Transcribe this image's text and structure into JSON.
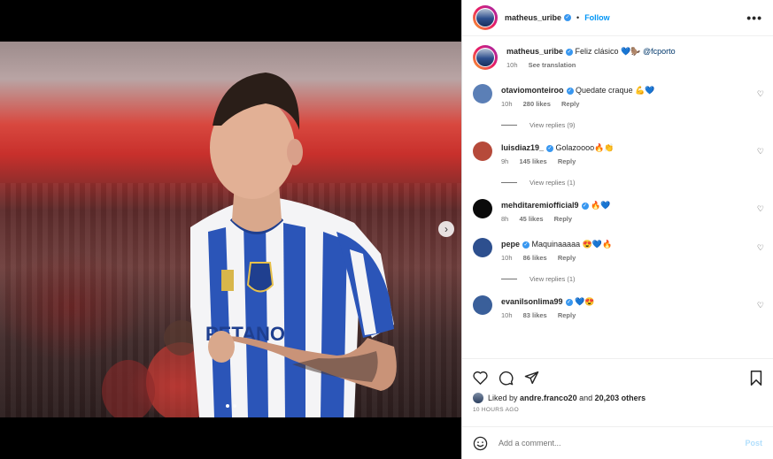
{
  "post": {
    "username": "matheus_uribe",
    "follow_label": "Follow",
    "separator": "•",
    "more_label": "•••"
  },
  "caption": {
    "username": "matheus_uribe",
    "text": "Feliz clásico 💙🦫",
    "mention": "@fcporto",
    "time": "10h",
    "see_translation": "See translation"
  },
  "comments": [
    {
      "username": "otaviomonteiroo",
      "text": "Quedate craque 💪💙",
      "time": "10h",
      "likes": "280 likes",
      "reply": "Reply",
      "view_replies": "View replies (9)",
      "avatar_color": "#5b7fb6"
    },
    {
      "username": "luisdiaz19_",
      "text": "Golazoooo🔥👏",
      "time": "9h",
      "likes": "145 likes",
      "reply": "Reply",
      "view_replies": "View replies (1)",
      "avatar_color": "#b64a3a"
    },
    {
      "username": "mehditaremiofficial9",
      "text": "🔥💙",
      "time": "8h",
      "likes": "45 likes",
      "reply": "Reply",
      "avatar_color": "#0a0a0a"
    },
    {
      "username": "pepe",
      "text": "Maquinaaaaa 😍💙🔥",
      "time": "10h",
      "likes": "86 likes",
      "reply": "Reply",
      "view_replies": "View replies (1)",
      "avatar_color": "#2d4f8e"
    },
    {
      "username": "evanilsonlima99",
      "text": "💙😍",
      "time": "10h",
      "likes": "83 likes",
      "reply": "Reply",
      "avatar_color": "#3a5f9a"
    }
  ],
  "likes": {
    "prefix": "Liked by",
    "user": "andre.franco20",
    "and": "and",
    "others": "20,203 others",
    "time_ago": "10 HOURS AGO"
  },
  "add_comment": {
    "placeholder": "Add a comment...",
    "post_label": "Post"
  },
  "media": {
    "carousel_dots": 2,
    "active_dot": 0,
    "next_icon": "chevron-right-icon"
  },
  "colors": {
    "accent": "#0095f6",
    "verified": "#3897f0",
    "jersey_blue": "#2b55b8"
  }
}
